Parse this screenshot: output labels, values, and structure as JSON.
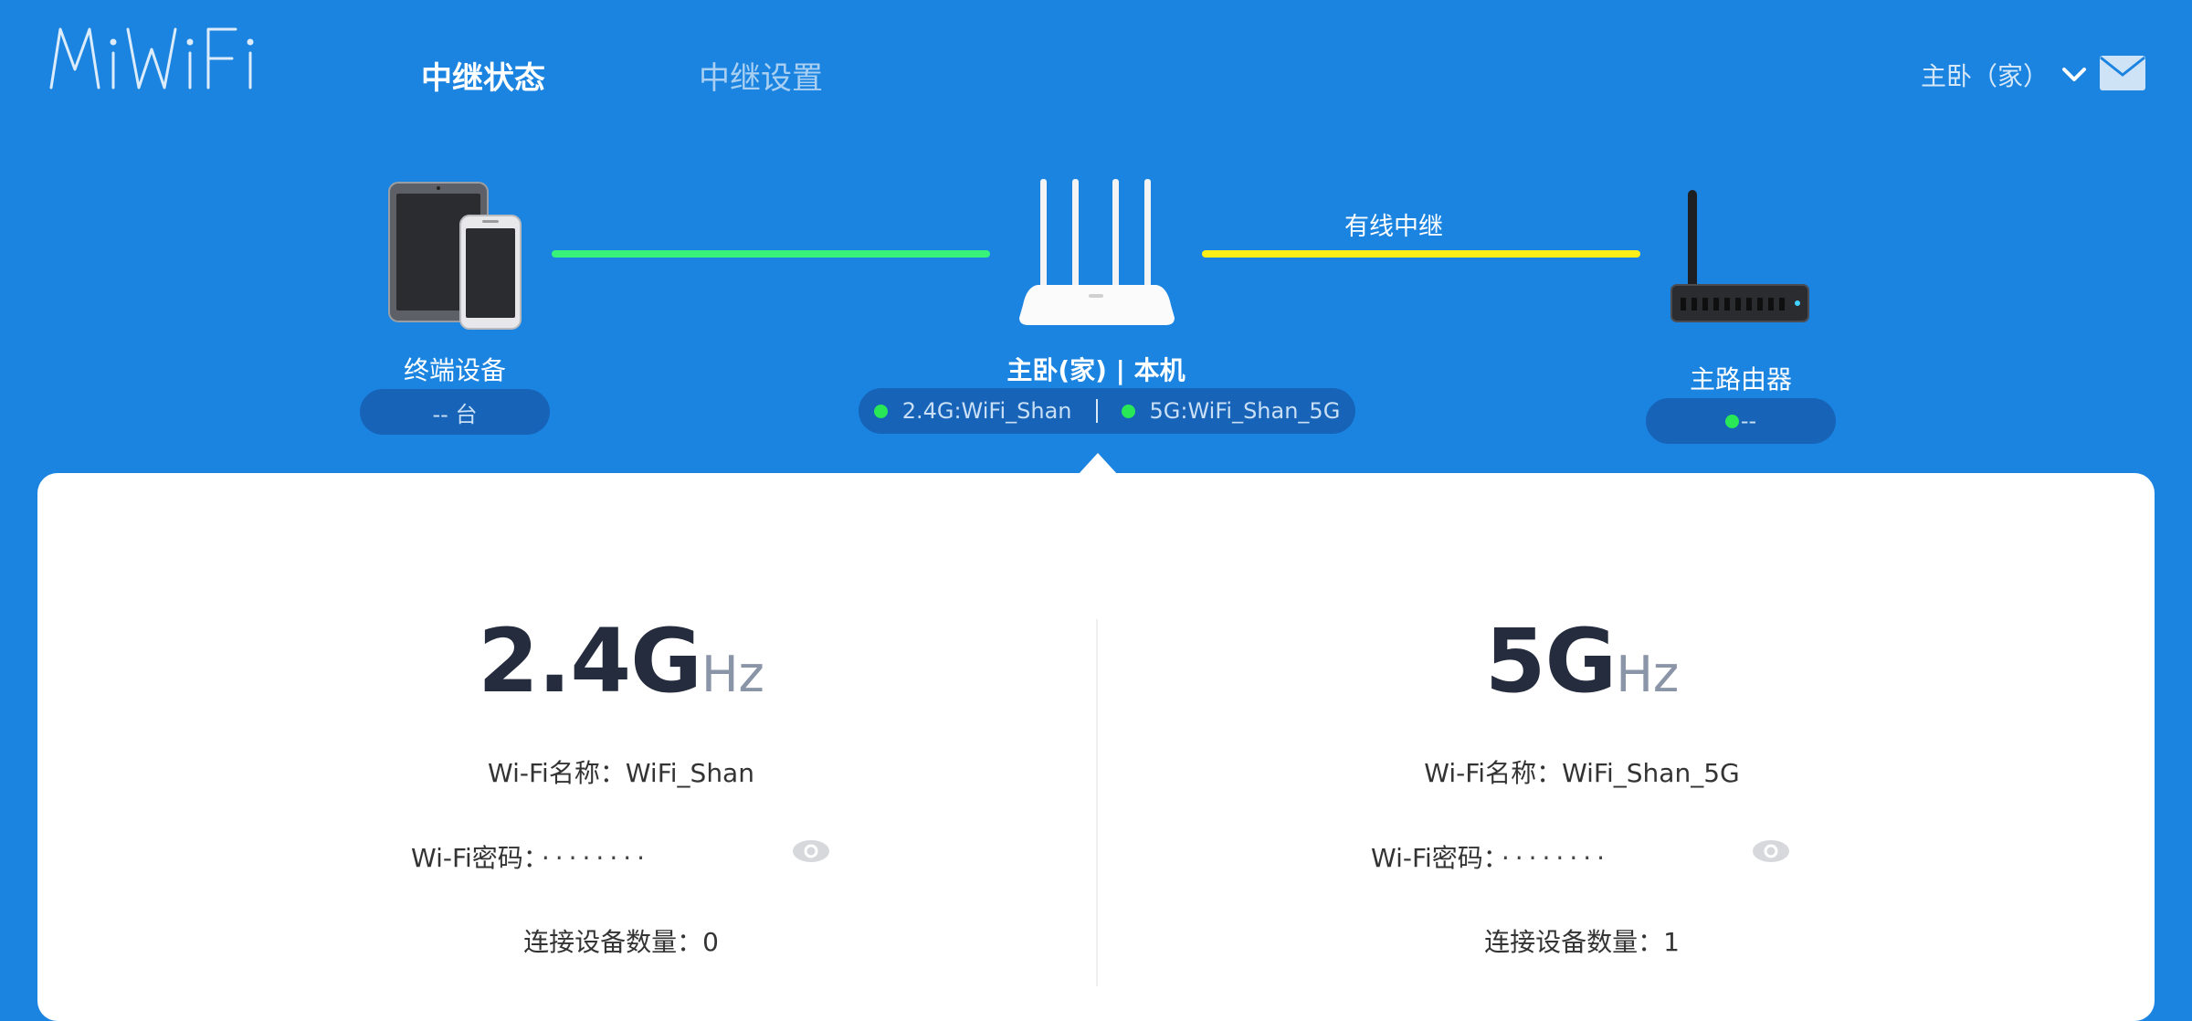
{
  "header": {
    "logo_text": "MiWiFi",
    "tabs": [
      {
        "label": "中继状态",
        "active": true
      },
      {
        "label": "中继设置",
        "active": false
      }
    ],
    "device_select": "主卧（家）",
    "icons": {
      "dropdown": "chevron-down-icon",
      "mail": "mail-icon"
    }
  },
  "topology": {
    "terminal": {
      "label": "终端设备",
      "count": "-- 台",
      "icon": "devices-icon"
    },
    "self": {
      "label": "主卧(家) | 本机",
      "wifi_24": "2.4G:WiFi_Shan",
      "wifi_5": "5G:WiFi_Shan_5G",
      "icon": "router-icon"
    },
    "link_label": "有线中继",
    "main_router": {
      "label": "主路由器",
      "status": "--",
      "icon": "main-router-icon"
    },
    "colors": {
      "client_link": "#38f27a",
      "wired_link": "#ffef18",
      "status_dot": "#29e857",
      "background": "#1b84e0"
    }
  },
  "bands": [
    {
      "band": "2.4G",
      "unit": "Hz",
      "name_label": "Wi-Fi名称：",
      "name_value": "WiFi_Shan",
      "pw_label": "Wi-Fi密码：",
      "pw_value": "········",
      "count_label": "连接设备数量：",
      "count_value": "0"
    },
    {
      "band": "5G",
      "unit": "Hz",
      "name_label": "Wi-Fi名称：",
      "name_value": "WiFi_Shan_5G",
      "pw_label": "Wi-Fi密码：",
      "pw_value": "········",
      "count_label": "连接设备数量：",
      "count_value": "1"
    }
  ]
}
